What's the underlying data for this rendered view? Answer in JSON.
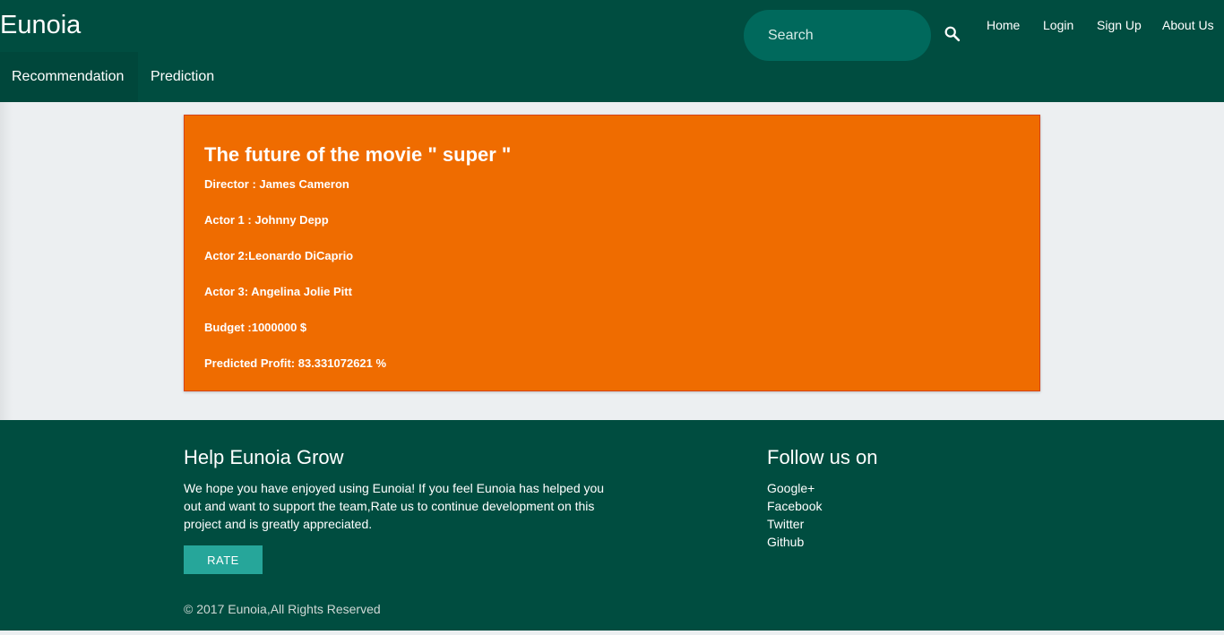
{
  "header": {
    "brand": "Eunoia",
    "search_placeholder": "Search",
    "nav": [
      "Home",
      "Login",
      "Sign Up",
      "About Us"
    ],
    "tabs": [
      "Recommendation",
      "Prediction"
    ]
  },
  "card": {
    "title": "The future of the movie \" super \"",
    "lines": [
      "Director : James Cameron",
      "Actor 1 : Johnny Depp",
      "Actor 2:Leonardo DiCaprio",
      "Actor 3: Angelina Jolie Pitt",
      "Budget :1000000 $",
      "Predicted Profit: 83.331072621 %"
    ]
  },
  "footer": {
    "help_title": "Help Eunoia Grow",
    "help_text": "We hope you have enjoyed using Eunoia! If you feel Eunoia has helped you out and want to support the team,Rate us to continue development on this project and is greatly appreciated.",
    "rate_label": "RATE",
    "follow_title": "Follow us on",
    "follow_links": [
      "Google+",
      "Facebook",
      "Twitter",
      "Github"
    ],
    "copyright": "© 2017 Eunoia,All Rights Reserved"
  },
  "colors": {
    "header": "#004d40",
    "search_bg": "#00695c",
    "card": "#ef6c00",
    "rate_button": "#26a69a",
    "page_bg": "#eceff1"
  },
  "icons": [
    "search-icon"
  ]
}
